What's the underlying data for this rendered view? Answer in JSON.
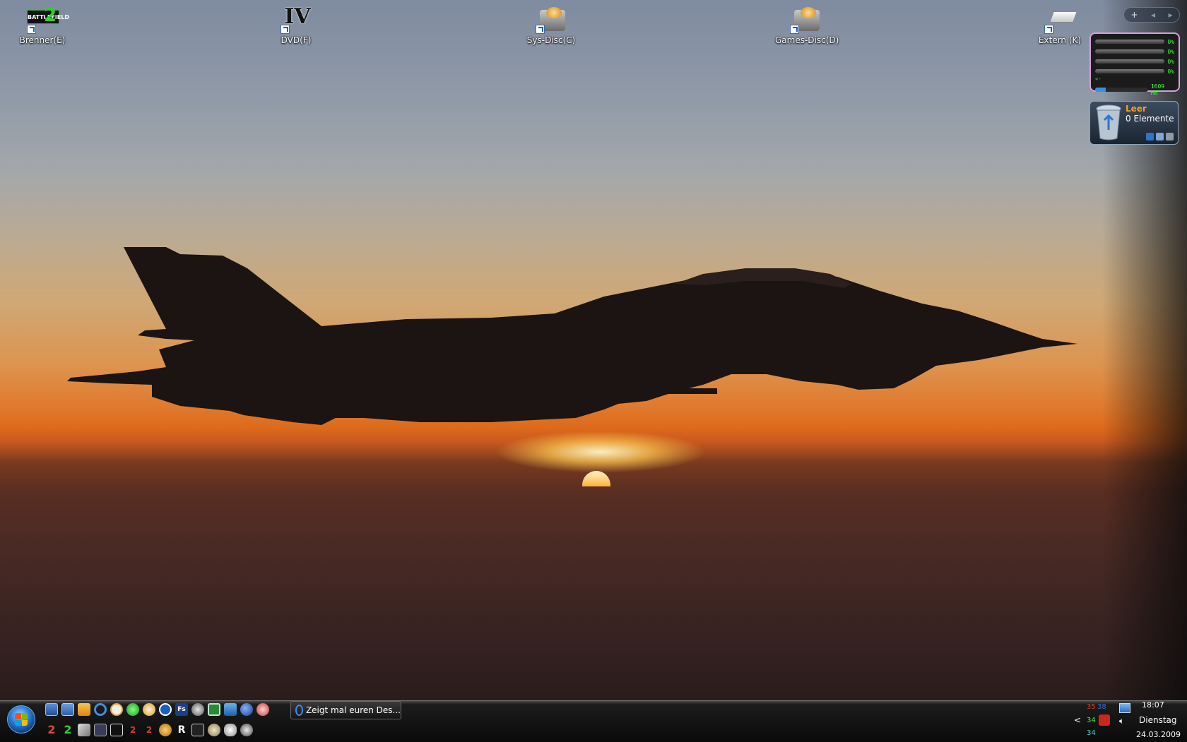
{
  "desktop": {
    "icons": [
      {
        "label": "Brenner(E)",
        "icon": "battlefield-game-icon"
      },
      {
        "label": "DVD(F)",
        "icon": "gta-iv-disc-icon"
      },
      {
        "label": "Sys-Disc(C)",
        "icon": "hard-disk-icon"
      },
      {
        "label": "Games-Disc(D)",
        "icon": "hard-disk-icon"
      },
      {
        "label": "Extern (K)",
        "icon": "external-drive-icon"
      }
    ],
    "icon_overlay_text": {
      "battlefield": "BATTLEFIELD",
      "gta": "IV"
    }
  },
  "gadgets": {
    "controls": {
      "add": "+",
      "prev": "◂",
      "next": "▸"
    },
    "cpu_meter": {
      "cores": [
        "0%",
        "0%",
        "0%",
        "0%"
      ],
      "mem_label": "<-",
      "mem_value": "1609 MB",
      "mem_fraction": 0.2
    },
    "recycle_bin": {
      "title": "Leer",
      "count": "0 Elemente"
    }
  },
  "taskbar": {
    "quick_launch_row1": [
      "show-desktop-icon",
      "switch-windows-icon",
      "media-player-icon",
      "internet-explorer-icon",
      "messenger-icon",
      "green-orb-icon",
      "audio-icon",
      "download-icon",
      "fs-icon",
      "steam-icon",
      "ccleaner-icon",
      "network-icon",
      "firefox-icon",
      "game-icon"
    ],
    "quick_launch_row2": [
      "2",
      "2",
      "wrench-icon",
      "cmd-icon",
      "tool-icon",
      "2",
      "2",
      "uplay-icon",
      "rockstar-icon",
      "zip-icon",
      "bulldog-icon",
      "skull-icon",
      "globe-icon"
    ],
    "window": {
      "label": "Zeigt mal euren Des..."
    },
    "tray": {
      "net_a": "35",
      "net_b": "38",
      "temp1": "34",
      "temp2": "34",
      "chevron": "<"
    },
    "clock": {
      "time": "18:07",
      "day": "Dienstag",
      "date": "24.03.2009"
    }
  },
  "colors": {
    "cpu_text": "#3bff3b",
    "bin_title": "#ff9c1e",
    "accent": "#3a8ee8"
  }
}
